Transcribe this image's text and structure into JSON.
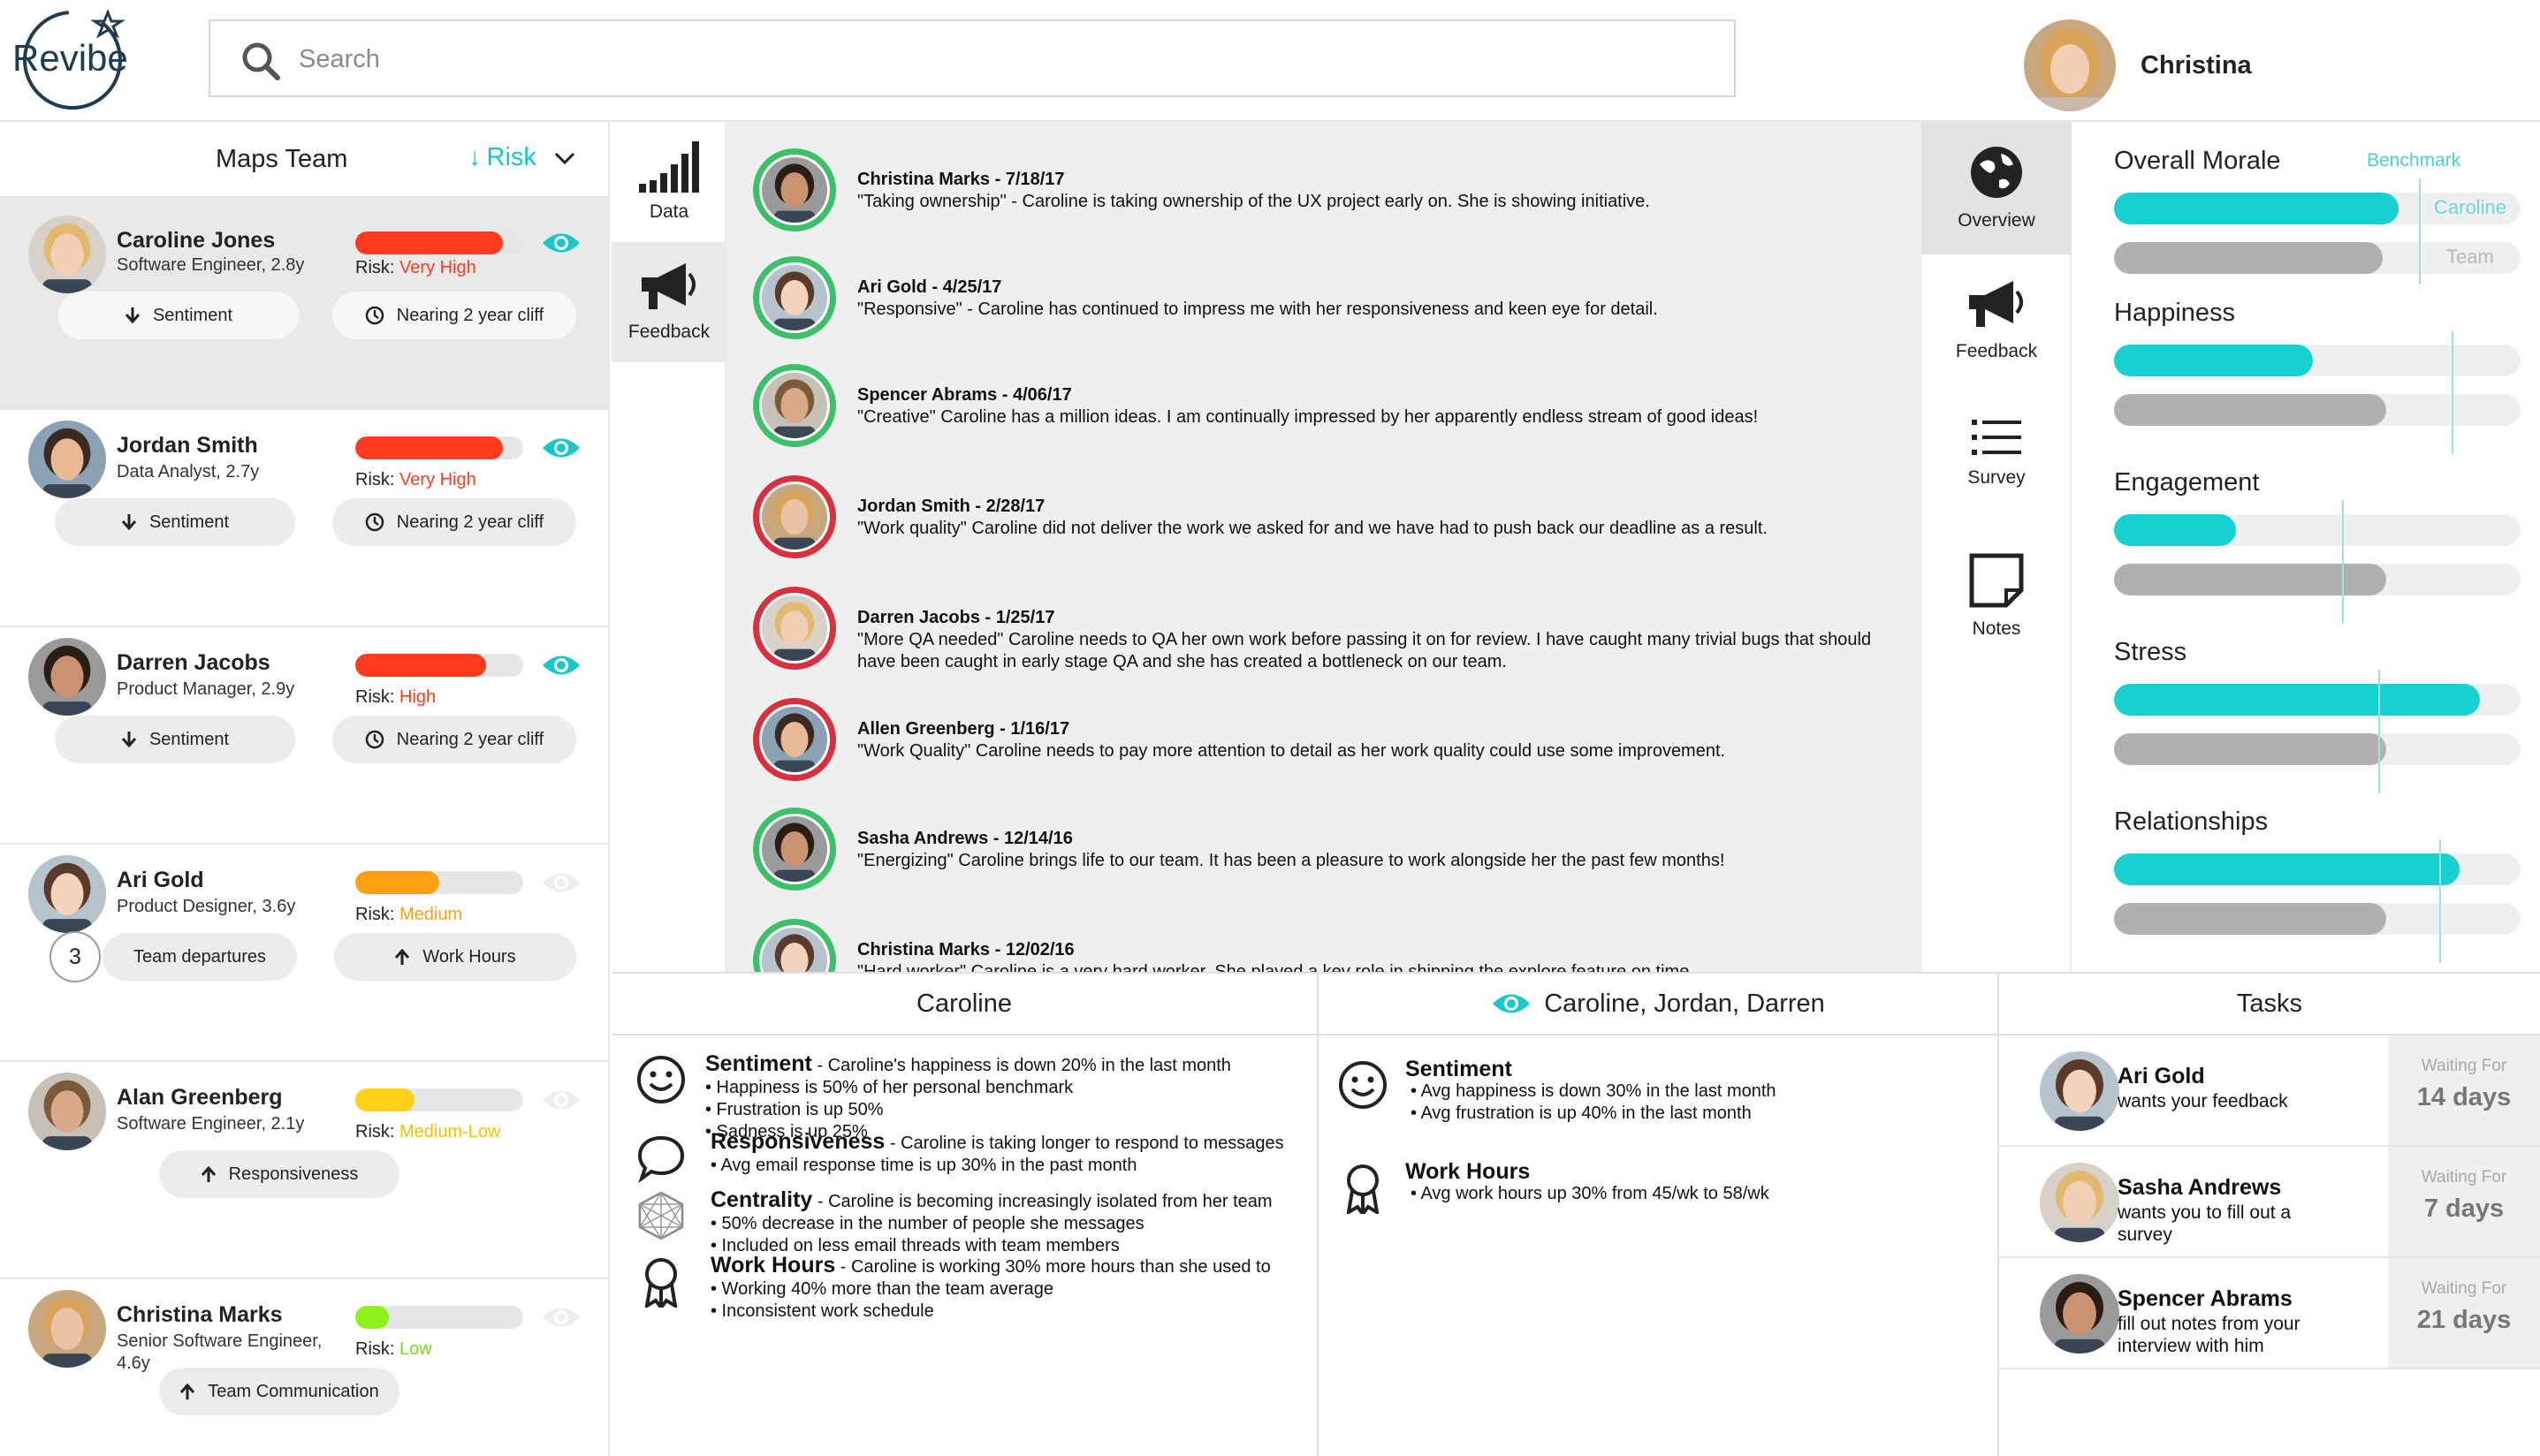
{
  "app": {
    "logo_text": "Revibe"
  },
  "search": {
    "placeholder": "Search"
  },
  "user": {
    "name": "Christina"
  },
  "team_panel": {
    "team_name": "Maps Team",
    "sort_label": "Risk",
    "employees": [
      {
        "name": "Caroline Jones",
        "role": "Software Engineer, 2.8y",
        "risk_label": "Risk: ",
        "risk": "Very High",
        "risk_level": 0.88,
        "color": "#ff3b1f",
        "risk_color": "#ff3b1f",
        "watched": true,
        "actions": [
          "Sentiment",
          "Nearing 2 year cliff"
        ]
      },
      {
        "name": "Jordan Smith",
        "role": "Data Analyst, 2.7y",
        "risk_label": "Risk: ",
        "risk": "Very High",
        "risk_level": 0.88,
        "color": "#ff3b1f",
        "risk_color": "#ff3b1f",
        "watched": true,
        "actions": [
          "Sentiment",
          "Nearing 2 year cliff"
        ]
      },
      {
        "name": "Darren Jacobs",
        "role": "Product Manager, 2.9y",
        "risk_label": "Risk: ",
        "risk": "High",
        "risk_level": 0.78,
        "color": "#ff3b1f",
        "risk_color": "#ff3b1f",
        "watched": true,
        "actions": [
          "Sentiment",
          "Nearing 2 year cliff"
        ]
      },
      {
        "name": "Ari Gold",
        "role": "Product Designer, 3.6y",
        "risk_label": "Risk: ",
        "risk": "Medium",
        "risk_level": 0.5,
        "color": "#ff9f12",
        "risk_color": "#ff9f12",
        "watched": false,
        "departures": "3",
        "actions": [
          "Team departures",
          "Work Hours"
        ]
      },
      {
        "name": "Alan Greenberg",
        "role": "Software Engineer, 2.1y",
        "risk_label": "Risk: ",
        "risk": "Medium-Low",
        "risk_level": 0.35,
        "color": "#ffd21a",
        "risk_color": "#f3c300",
        "watched": false,
        "actions": [
          "Responsiveness"
        ]
      },
      {
        "name": "Christina Marks",
        "role": "Senior Software Engineer, 4.6y",
        "risk_label": "Risk: ",
        "risk": "Low",
        "risk_level": 0.2,
        "color": "#8ef21a",
        "risk_color": "#7bd81a",
        "watched": false,
        "actions": [
          "Team Communication"
        ]
      }
    ]
  },
  "data_tabs": [
    {
      "label": "Data"
    },
    {
      "label": "Feedback"
    }
  ],
  "feedback": [
    {
      "header": "Christina Marks - 7/18/17",
      "text": "\"Taking ownership\" - Caroline is taking ownership of the UX project early on. She is showing initiative.",
      "tone": "positive"
    },
    {
      "header": "Ari Gold - 4/25/17",
      "text": "\"Responsive\" - Caroline has continued to impress me with her responsiveness and keen eye for detail.",
      "tone": "positive"
    },
    {
      "header": "Spencer Abrams - 4/06/17",
      "text": "\"Creative\" Caroline has a million ideas. I am continually impressed by her apparently endless stream of good ideas!",
      "tone": "positive"
    },
    {
      "header": "Jordan Smith - 2/28/17",
      "text": "\"Work quality\" Caroline did not deliver the work we asked for and we have had to push back our deadline as a result.",
      "tone": "negative"
    },
    {
      "header": "Darren Jacobs - 1/25/17",
      "text": "\"More QA needed\" Caroline needs to QA her own work before passing it on for review. I have caught many trivial bugs that should have been caught in early stage QA and she has created a bottleneck on our team.",
      "tone": "negative"
    },
    {
      "header": "Allen Greenberg - 1/16/17",
      "text": "\"Work Quality\" Caroline needs to pay more attention to detail as her work quality could use some improvement.",
      "tone": "negative"
    },
    {
      "header": "Sasha Andrews - 12/14/16",
      "text": "\"Energizing\" Caroline brings life to our team. It has been a pleasure to work alongside her the past few months!",
      "tone": "positive"
    },
    {
      "header": "Christina Marks - 12/02/16",
      "text": "\"Hard worker\" Caroline is a very hard worker. She played a key role in shipping the explore feature on time.",
      "tone": "positive"
    }
  ],
  "side_nav": [
    {
      "label": "Overview"
    },
    {
      "label": "Feedback"
    },
    {
      "label": "Survey"
    },
    {
      "label": "Notes"
    }
  ],
  "morale": {
    "benchmark_label": "Benchmark",
    "caroline_label": "Caroline",
    "team_label": "Team",
    "accent": "#18d0d0",
    "team_color": "#b0b0b0",
    "metrics": [
      {
        "name": "Overall Morale",
        "caroline": 0.7,
        "team": 0.66,
        "benchmark": 0.75
      },
      {
        "name": "Happiness",
        "caroline": 0.49,
        "team": 0.67,
        "benchmark": 0.83
      },
      {
        "name": "Engagement",
        "caroline": 0.3,
        "team": 0.67,
        "benchmark": 0.56
      },
      {
        "name": "Stress",
        "caroline": 0.9,
        "team": 0.67,
        "benchmark": 0.65
      },
      {
        "name": "Relationships",
        "caroline": 0.85,
        "team": 0.67,
        "benchmark": 0.8
      }
    ]
  },
  "caroline_panel": {
    "title": "Caroline",
    "insights": [
      {
        "title": "Sentiment",
        "summary": " - Caroline's happiness is down 20% in the last month",
        "bullets": [
          "• Happiness is 50% of her personal benchmark",
          "• Frustration is up 50%",
          "• Sadness is up 25%"
        ]
      },
      {
        "title": "Responsiveness",
        "summary": " - Caroline is taking longer to respond to messages",
        "bullets": [
          "• Avg email response time is up 30% in the past month"
        ]
      },
      {
        "title": "Centrality",
        "summary": " - Caroline is becoming increasingly isolated from her team",
        "bullets": [
          "• 50% decrease in the number of people she messages",
          "• Included on less email threads with team members"
        ]
      },
      {
        "title": "Work Hours",
        "summary": " - Caroline is working 30% more hours than she used to",
        "bullets": [
          "• Working 40% more than the team average",
          "• Inconsistent work schedule"
        ]
      }
    ]
  },
  "group_panel": {
    "title": "Caroline, Jordan, Darren",
    "insights": [
      {
        "title": "Sentiment",
        "bullets": [
          "• Avg happiness is down 30% in the last month",
          "• Avg frustration is up 40% in the last month"
        ]
      },
      {
        "title": "Work Hours",
        "bullets": [
          "• Avg work hours up 30% from 45/wk to 58/wk"
        ]
      }
    ]
  },
  "tasks": {
    "title": "Tasks",
    "waiting_label": "Waiting For",
    "items": [
      {
        "name": "Ari Gold",
        "desc": "wants your feedback",
        "wait": "14 days"
      },
      {
        "name": "Sasha Andrews",
        "desc": "wants you to fill out a survey",
        "wait": "7 days"
      },
      {
        "name": "Spencer Abrams",
        "desc": "fill out notes from your interview with him",
        "wait": "21 days"
      }
    ]
  }
}
